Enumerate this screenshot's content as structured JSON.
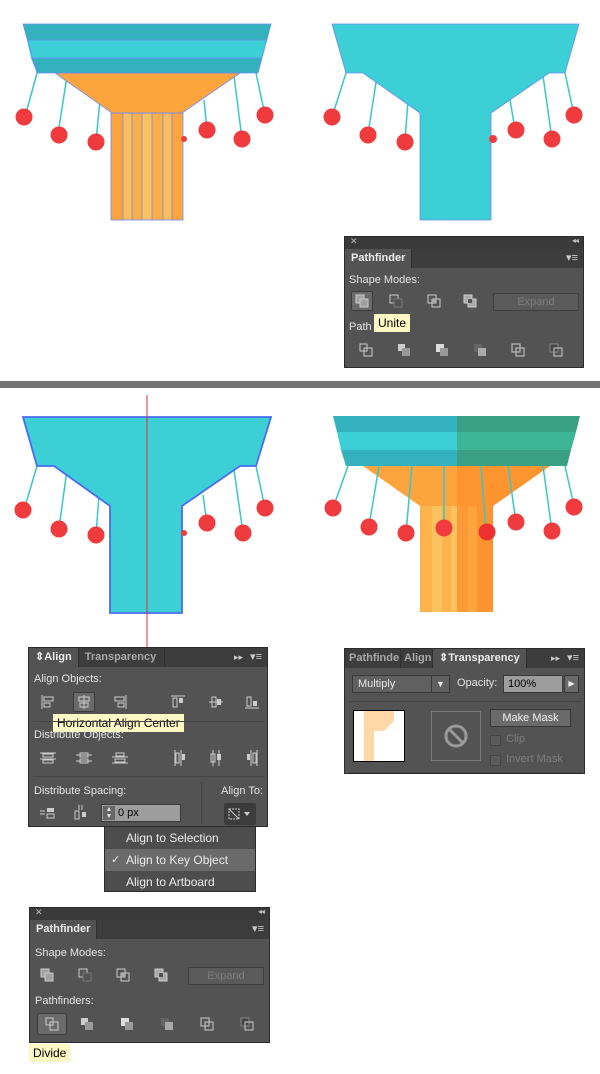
{
  "colors": {
    "teal_dark": "#33b2bd",
    "teal_light": "#3ccfd6",
    "green_dark": "#39a084",
    "green_light": "#3db597",
    "orange": "#fca53f",
    "orange_dark": "#fc9530",
    "orange_light": "#fdc260",
    "red": "#ef3a3e",
    "line": "#39c6cd",
    "anchor": "#4a6cf0",
    "guide": "#e0323b",
    "panel_bg": "#535353",
    "tooltip_bg": "#fdf7c4"
  },
  "step1_pathfinder": {
    "tab": "Pathfinder",
    "shape_modes_label": "Shape Modes:",
    "pathfinders_label_partial": "Path",
    "expand_label": "Expand",
    "tooltip": "Unite",
    "shape_mode_icons": [
      "unite-icon",
      "minus-front-icon",
      "intersect-icon",
      "exclude-icon"
    ],
    "pathfinder_icons": [
      "divide-icon",
      "trim-icon",
      "merge-icon",
      "crop-icon",
      "outline-icon",
      "minus-back-icon"
    ]
  },
  "align_panel": {
    "tabs": [
      "Align",
      "Transparency"
    ],
    "active_tab": "Align",
    "align_objects_label": "Align Objects:",
    "align_icons": [
      "horizontal-align-left-icon",
      "horizontal-align-center-icon",
      "horizontal-align-right-icon",
      "vertical-align-top-icon",
      "vertical-align-center-icon",
      "vertical-align-bottom-icon"
    ],
    "tooltip": "Horizontal Align Center",
    "distribute_objects_label": "Distribute Objects:",
    "distribute_icons": [
      "vertical-distribute-top-icon",
      "vertical-distribute-center-icon",
      "vertical-distribute-bottom-icon",
      "horizontal-distribute-left-icon",
      "horizontal-distribute-center-icon",
      "horizontal-distribute-right-icon"
    ],
    "distribute_spacing_label": "Distribute Spacing:",
    "spacing_value": "0 px",
    "align_to_label": "Align To:",
    "align_to_menu": [
      {
        "label": "Align to Selection",
        "checked": false
      },
      {
        "label": "Align to Key Object",
        "checked": true
      },
      {
        "label": "Align to Artboard",
        "checked": false
      }
    ]
  },
  "transparency_panel": {
    "tabs": [
      "Pathfinde",
      "Align",
      "Transparency"
    ],
    "active_tab": "Transparency",
    "blend_mode": "Multiply",
    "opacity_label": "Opacity:",
    "opacity_value": "100%",
    "make_mask_label": "Make Mask",
    "clip_label": "Clip",
    "invert_mask_label": "Invert Mask",
    "clip_checked": false,
    "invert_mask_checked": false
  },
  "step4_pathfinder": {
    "tab": "Pathfinder",
    "shape_modes_label": "Shape Modes:",
    "pathfinders_label": "Pathfinders:",
    "expand_label": "Expand",
    "tooltip": "Divide"
  }
}
